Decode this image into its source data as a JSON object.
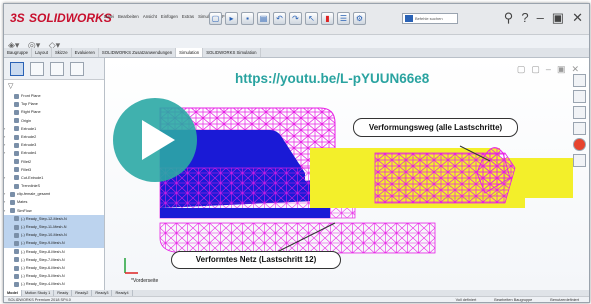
{
  "app": {
    "logo": "SOLIDWORKS",
    "menu": [
      "Datei",
      "Bearbeiten",
      "Ansicht",
      "Einfügen",
      "Extras",
      "Simulation",
      "Fenster",
      "Hilfe"
    ],
    "search_placeholder": "Befehle suchen",
    "help_label": "?"
  },
  "command_tabs": [
    "Baugruppe",
    "Layout",
    "Skizze",
    "Evaluieren",
    "SOLIDWORKS Zusatzanwendungen",
    "Simulation",
    "SOLIDWORKS Simulation"
  ],
  "active_command_tab": "Simulation",
  "feature_tree": {
    "items": [
      {
        "label": "Front Plane"
      },
      {
        "label": "Top Plane"
      },
      {
        "label": "Right Plane"
      },
      {
        "label": "Origin"
      },
      {
        "label": "Extrude1"
      },
      {
        "label": "Extrude2"
      },
      {
        "label": "Extrude3"
      },
      {
        "label": "Extrude4"
      },
      {
        "label": "Fillet2"
      },
      {
        "label": "Fillet3"
      },
      {
        "label": "Cut-Extrude1"
      },
      {
        "label": "TrennlinieS"
      },
      {
        "label": "clip-female_gesamt"
      },
      {
        "label": "Mates"
      },
      {
        "label": "SimFlow"
      },
      {
        "label": "(-) Ready_Step-12-Mesh-N",
        "selected": true
      },
      {
        "label": "(-) Ready_Step-11-Mesh-N",
        "selected": true
      },
      {
        "label": "(-) Ready_Step-10-Mesh-N",
        "selected": true
      },
      {
        "label": "(-) Ready_Step-9-Mesh-N",
        "selected": true
      },
      {
        "label": "(-) Ready_Step-8-Mesh-N"
      },
      {
        "label": "(-) Ready_Step-7-Mesh-N"
      },
      {
        "label": "(-) Ready_Step-6-Mesh-N"
      },
      {
        "label": "(-) Ready_Step-5-Mesh-N"
      },
      {
        "label": "(-) Ready_Step-4-Mesh-N"
      }
    ]
  },
  "graphics": {
    "url": "https://youtu.be/L-pYUUN66e8",
    "callout_top": "Verformungsweg (alle Lastschritte)",
    "callout_bottom": "Verformtes Netz (Lastschritt 12)",
    "triad_label": "*Vorderseite",
    "colors": {
      "mesh": "#e81ee6",
      "blue_part": "#1a1ad6",
      "yellow_part": "#f3ef2a",
      "play_teal": "#2ba8a5"
    }
  },
  "bottom_tabs": [
    "Model",
    "Motion Study 1",
    "Ready",
    "Ready2",
    "Ready3",
    "Ready4"
  ],
  "active_bottom_tab": "Model",
  "status": {
    "left": "SOLIDWORKS Premium 2018 SP4.0",
    "right": [
      "Voll definiert",
      "Bearbeiten Baugruppe",
      "Benutzerdefiniert"
    ]
  }
}
